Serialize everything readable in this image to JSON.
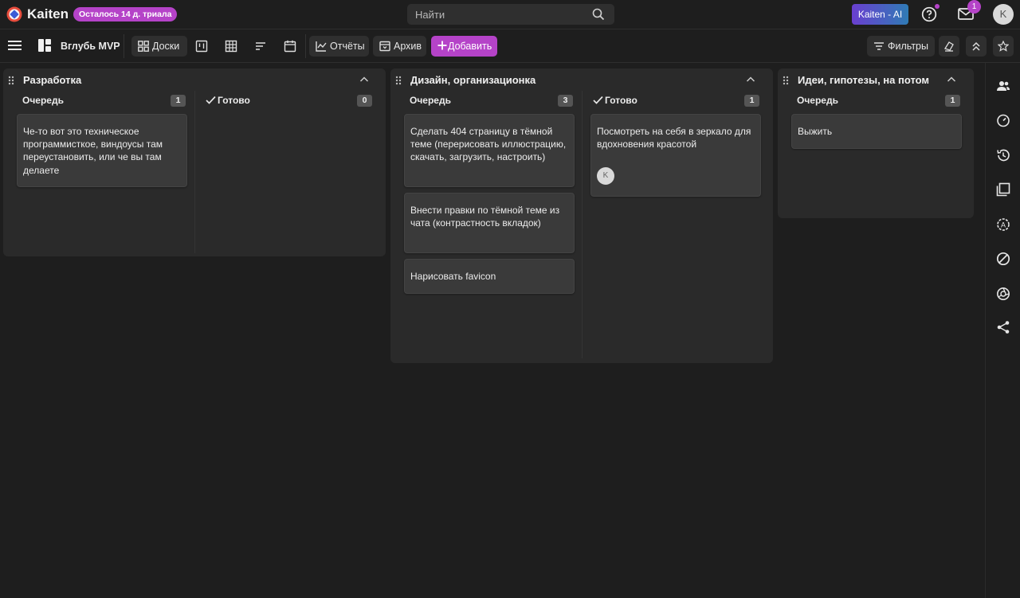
{
  "app": {
    "brand": "Kaiten",
    "trial_badge": "Осталось 14 д. триала",
    "search_placeholder": "Найти",
    "ai_button": "Kaiten - AI",
    "notification_count": "1",
    "user_initial": "K"
  },
  "toolbar": {
    "space_name": "Вглубь MVP",
    "boards_label": "Доски",
    "reports_label": "Отчёты",
    "archive_label": "Архив",
    "add_label": "Добавить",
    "filters_label": "Фильтры"
  },
  "boards": [
    {
      "title": "Разработка",
      "columns": [
        {
          "title": "Очередь",
          "count": "1",
          "cards": [
            {
              "text": "Че-то вот это техническое программисткое, виндоусы там переустановить, или че вы там делаете"
            }
          ]
        },
        {
          "title": "Готово",
          "count": "0",
          "cards": []
        }
      ]
    },
    {
      "title": "Дизайн, организационка",
      "columns": [
        {
          "title": "Очередь",
          "count": "3",
          "cards": [
            {
              "text": "Сделать 404 страницу в тёмной теме (перерисовать иллюстрацию, скачать, загрузить, настроить)"
            },
            {
              "text": "Внести правки по тёмной теме из чата (контрастность вкладок)"
            },
            {
              "text": "Нарисовать favicon"
            }
          ]
        },
        {
          "title": "Готово",
          "count": "1",
          "cards": [
            {
              "text": "Посмотреть на себя в зеркало для вдохновения красотой",
              "avatar": "K"
            }
          ]
        }
      ]
    },
    {
      "title": "Идеи, гипотезы, на потом",
      "columns": [
        {
          "title": "Очередь",
          "count": "1",
          "cards": [
            {
              "text": "Выжить"
            }
          ]
        }
      ]
    }
  ],
  "colors": {
    "accent": "#b543c8",
    "background": "#1e1e1e",
    "board": "#2a2a2a",
    "card": "#3a3a3a"
  },
  "icons": [
    "menu-icon",
    "board-view-icon",
    "search-icon",
    "help-icon",
    "mail-icon",
    "users-icon",
    "timer-icon",
    "history-icon",
    "copy-icon",
    "automation-icon",
    "block-icon",
    "aperture-icon",
    "share-icon",
    "star-icon"
  ]
}
